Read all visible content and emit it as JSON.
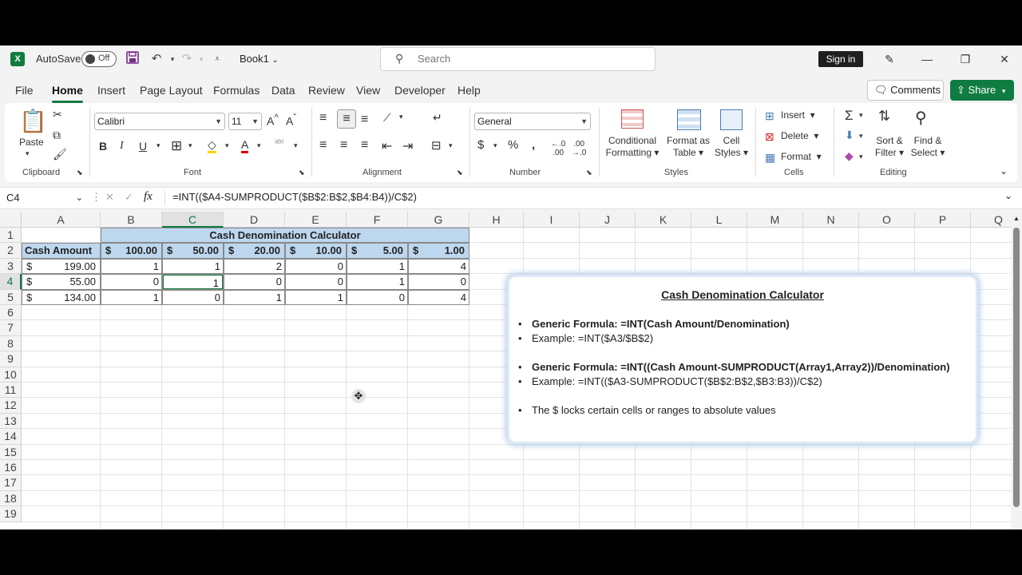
{
  "titlebar": {
    "logo": "X",
    "autosave_label": "AutoSave",
    "autosave_state": "Off",
    "book_name": "Book1",
    "search_placeholder": "Search",
    "sign_in": "Sign in"
  },
  "menu": {
    "tabs": [
      "File",
      "Home",
      "Insert",
      "Page Layout",
      "Formulas",
      "Data",
      "Review",
      "View",
      "Developer",
      "Help"
    ],
    "active": "Home",
    "comments": "Comments",
    "share": "Share"
  },
  "ribbon": {
    "clipboard": {
      "label": "Clipboard",
      "paste": "Paste"
    },
    "font": {
      "label": "Font",
      "family": "Calibri",
      "size": "11"
    },
    "alignment": {
      "label": "Alignment"
    },
    "number": {
      "label": "Number",
      "format": "General"
    },
    "styles": {
      "label": "Styles",
      "conditional_1": "Conditional",
      "conditional_2": "Formatting",
      "format_table_1": "Format as",
      "format_table_2": "Table",
      "cell_styles_1": "Cell",
      "cell_styles_2": "Styles"
    },
    "cells": {
      "label": "Cells",
      "insert": "Insert",
      "delete": "Delete",
      "format": "Format"
    },
    "editing": {
      "label": "Editing",
      "sort_1": "Sort &",
      "sort_2": "Filter",
      "find_1": "Find &",
      "find_2": "Select"
    }
  },
  "formula_bar": {
    "name_box": "C4",
    "formula": "=INT(($A4-SUMPRODUCT($B$2:B$2,$B4:B4))/C$2)"
  },
  "sheet": {
    "columns": [
      "A",
      "B",
      "C",
      "D",
      "E",
      "F",
      "G",
      "H",
      "I",
      "J",
      "K",
      "L",
      "M",
      "N",
      "O",
      "P",
      "Q"
    ],
    "rows": [
      "1",
      "2",
      "3",
      "4",
      "5",
      "6",
      "7",
      "8",
      "9",
      "10",
      "11",
      "12",
      "13",
      "14",
      "15",
      "16",
      "17",
      "18",
      "19"
    ],
    "selected_col": "C",
    "selected_row": "4",
    "table_title": "Cash Denomination Calculator",
    "header_label": "Cash Amount",
    "denominations": [
      "100.00",
      "50.00",
      "20.00",
      "10.00",
      "5.00",
      "1.00"
    ],
    "currency_symbol": "$",
    "amounts": [
      "199.00",
      "55.00",
      "134.00"
    ],
    "results": [
      [
        "1",
        "1",
        "2",
        "0",
        "1",
        "4"
      ],
      [
        "0",
        "1",
        "0",
        "0",
        "1",
        "0"
      ],
      [
        "1",
        "0",
        "1",
        "1",
        "0",
        "4"
      ]
    ],
    "header_fill": "#bdd7ee"
  },
  "note": {
    "title": "Cash Denomination Calculator",
    "bullet": "•",
    "line1": "Generic Formula: =INT(Cash Amount/Denomination)",
    "line2": "Example: =INT($A3/$B$2)",
    "line3": "Generic Formula: =INT((Cash Amount-SUMPRODUCT(Array1,Array2))/Denomination)",
    "line4": "Example: =INT(($A3-SUMPRODUCT($B$2:B$2,$B3:B3))/C$2)",
    "line5": "The $ locks certain cells or ranges to absolute values"
  }
}
